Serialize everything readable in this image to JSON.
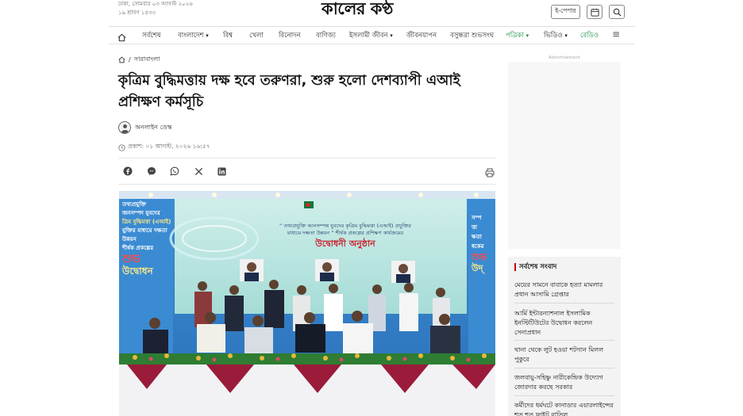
{
  "header": {
    "date_line1": "ঢাকা, সোমবার ০৩ আগস্ট ২০২৬",
    "date_line2": "১৯ শ্রাবণ ১৪৩৩",
    "logo_text": "কালের কণ্ঠ",
    "epaper_label": "ই-পেপার"
  },
  "nav": {
    "items": [
      {
        "label": "সর্বশেষ",
        "dropdown": false
      },
      {
        "label": "বাংলাদেশ",
        "dropdown": true
      },
      {
        "label": "বিশ্ব",
        "dropdown": false
      },
      {
        "label": "খেলা",
        "dropdown": false
      },
      {
        "label": "বিনোদন",
        "dropdown": false
      },
      {
        "label": "বাণিজ্য",
        "dropdown": false
      },
      {
        "label": "ইসলামী জীবন",
        "dropdown": true
      },
      {
        "label": "জীবনযাপন",
        "dropdown": false
      },
      {
        "label": "বসুন্ধরা শুভসংঘ",
        "dropdown": false
      },
      {
        "label": "পত্রিকা",
        "dropdown": true,
        "accent": true
      },
      {
        "label": "ভিডিও",
        "dropdown": true
      },
      {
        "label": "রেডিও",
        "dropdown": false,
        "accent": true
      }
    ]
  },
  "breadcrumb": {
    "section": "সারাবাংলা"
  },
  "article": {
    "headline": "কৃত্রিম বুদ্ধিমত্তায় দক্ষ হবে তরুণরা, শুরু হলো দেশব্যাপী এআই প্রশিক্ষণ কর্মসূচি",
    "author": "অনলাইন ডেস্ক",
    "published": "প্রকাশ: ০১ আগস্ট, ২০২৬ ১৬:৫৭"
  },
  "photo": {
    "banner_logo_text": "",
    "banner_line1": "“ তথ্যপ্রযুক্তি আনসম্পন্ন যুবদের কৃত্রিম বুদ্ধিমত্তা (এআই) প্রযুক্তির",
    "banner_line2": "মাধ্যমে দক্ষতা উন্নয়ন ” শীর্ষক প্রকল্পের প্রশিক্ষণ কার্যক্রমের",
    "banner_heading": "উদ্বোধনী অনুষ্ঠান",
    "left_banner_lines": [
      "তথ্যপ্রযুক্তি",
      "জনসম্পদ যুবদের",
      "ত্রিম বুদ্ধিমত্তা (এআই)",
      "যুক্তির মাধ্যমে দক্ষতা",
      "উন্নয়ন",
      "শীর্ষক প্রকল্পের",
      "শুভ",
      "উদ্বোধন"
    ],
    "right_banner_lines": [
      "সম্প",
      "ত্তা",
      "ক্ষতা",
      "ধকের",
      "শুভ",
      "উদ্"
    ]
  },
  "sidebar": {
    "ad_label": "Advertisement",
    "latest_title": "সর্বশেষ সংবাদ",
    "latest_items": [
      "মেয়ের সামনে বাবাকে হত্যা মামলার প্রধান আসামি গ্রেপ্তার",
      "আর্মি ইন্টারন্যাশনাল ইসলামিক ইনস্টিটিউটের উদ্বোধন করলেন সেনাপ্রধান",
      "থানা থেকে লুট হওয়া শটগান মিলল পুকুরে",
      "জলবায়ু-সহিষ্ণু নারীকেন্দ্রিক উদ্যোগ জোরদার করছে সরকার",
      "কর্মীদের ধর্মঘটে কানাডার এয়ারলাইন্সের শত শত ফ্লাইট বাতিল"
    ]
  },
  "colors": {
    "accent_green": "#0a8a3f",
    "accent_red": "#cc0000",
    "banner_blue": "#2f8fd8"
  }
}
